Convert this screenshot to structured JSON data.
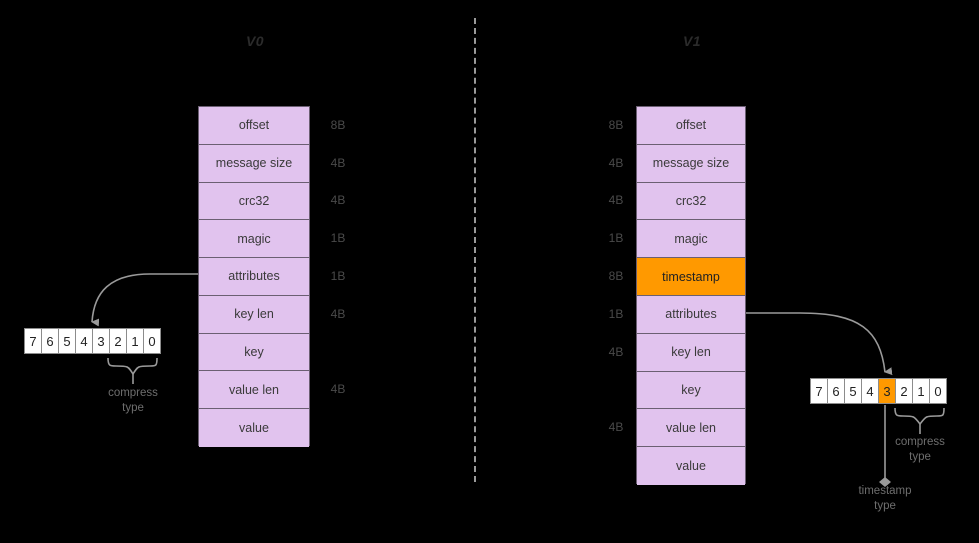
{
  "diagram": {
    "panels": [
      {
        "id": "v0",
        "title": "V0",
        "rows": [
          {
            "label": "offset",
            "size": "8B",
            "highlight": false
          },
          {
            "label": "message size",
            "size": "4B",
            "highlight": false
          },
          {
            "label": "crc32",
            "size": "4B",
            "highlight": false
          },
          {
            "label": "magic",
            "size": "1B",
            "highlight": false
          },
          {
            "label": "attributes",
            "size": "1B",
            "highlight": false
          },
          {
            "label": "key len",
            "size": "4B",
            "highlight": false
          },
          {
            "label": "key",
            "size": "",
            "highlight": false
          },
          {
            "label": "value len",
            "size": "4B",
            "highlight": false
          },
          {
            "label": "value",
            "size": "",
            "highlight": false
          }
        ],
        "bits": [
          {
            "label": "7",
            "on": false
          },
          {
            "label": "6",
            "on": false
          },
          {
            "label": "5",
            "on": false
          },
          {
            "label": "4",
            "on": false
          },
          {
            "label": "3",
            "on": false
          },
          {
            "label": "2",
            "on": false
          },
          {
            "label": "1",
            "on": false
          },
          {
            "label": "0",
            "on": false
          }
        ],
        "captions": {
          "compress_type": "compress\ntype"
        }
      },
      {
        "id": "v1",
        "title": "V1",
        "rows": [
          {
            "label": "offset",
            "size": "8B",
            "highlight": false
          },
          {
            "label": "message size",
            "size": "4B",
            "highlight": false
          },
          {
            "label": "crc32",
            "size": "4B",
            "highlight": false
          },
          {
            "label": "magic",
            "size": "1B",
            "highlight": false
          },
          {
            "label": "timestamp",
            "size": "8B",
            "highlight": true
          },
          {
            "label": "attributes",
            "size": "1B",
            "highlight": false
          },
          {
            "label": "key len",
            "size": "4B",
            "highlight": false
          },
          {
            "label": "key",
            "size": "",
            "highlight": false
          },
          {
            "label": "value len",
            "size": "4B",
            "highlight": false
          },
          {
            "label": "value",
            "size": "",
            "highlight": false
          }
        ],
        "bits": [
          {
            "label": "7",
            "on": false
          },
          {
            "label": "6",
            "on": false
          },
          {
            "label": "5",
            "on": false
          },
          {
            "label": "4",
            "on": false
          },
          {
            "label": "3",
            "on": true
          },
          {
            "label": "2",
            "on": false
          },
          {
            "label": "1",
            "on": false
          },
          {
            "label": "0",
            "on": false
          }
        ],
        "captions": {
          "compress_type": "compress\ntype",
          "timestamp_type": "timestamp\ntype"
        }
      }
    ],
    "colors": {
      "background": "#000000",
      "field_fill": "#e1c3ee",
      "field_border": "#6b5f72",
      "highlight_fill": "#ff9900",
      "connector": "#9a9a9a",
      "bit_fill": "#ffffff",
      "caption_text": "#6e6e6e",
      "title_text": "#2b2b2b"
    }
  }
}
